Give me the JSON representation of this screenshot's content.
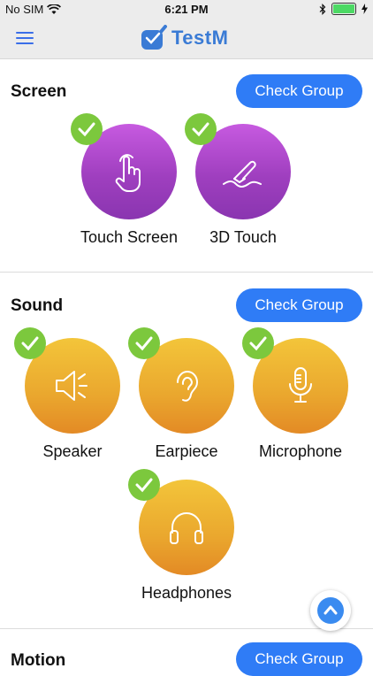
{
  "status_bar": {
    "carrier": "No SIM",
    "time": "6:21 PM",
    "battery_level": 1.0
  },
  "navbar": {
    "app_name": "TestM"
  },
  "sections": [
    {
      "title": "Screen",
      "button": "Check Group",
      "tests": [
        {
          "label": "Touch Screen",
          "icon": "touch-icon",
          "passed": true
        },
        {
          "label": "3D Touch",
          "icon": "3d-touch-icon",
          "passed": true
        }
      ]
    },
    {
      "title": "Sound",
      "button": "Check Group",
      "tests": [
        {
          "label": "Speaker",
          "icon": "speaker-icon",
          "passed": true
        },
        {
          "label": "Earpiece",
          "icon": "ear-icon",
          "passed": true
        },
        {
          "label": "Microphone",
          "icon": "microphone-icon",
          "passed": true
        },
        {
          "label": "Headphones",
          "icon": "headphones-icon",
          "passed": true
        }
      ]
    },
    {
      "title": "Motion",
      "button": "Check Group",
      "tests": []
    }
  ],
  "colors": {
    "accent": "#2f7cf6",
    "screen_tile": "#a945c9",
    "sound_tile": "#eba92e",
    "check_badge": "#7cc83d"
  }
}
